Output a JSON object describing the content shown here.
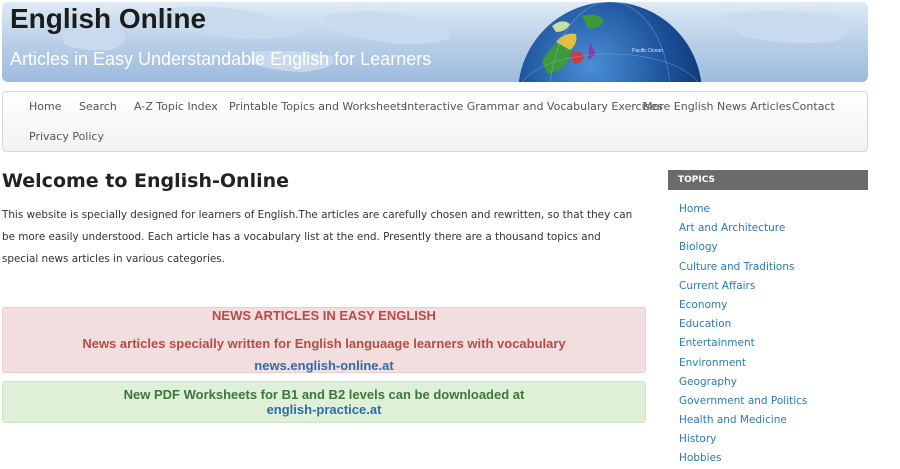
{
  "header": {
    "title": "English Online",
    "tagline": "Articles in Easy Understandable English for Learners",
    "globe_label": "Pacific Ocean"
  },
  "nav": {
    "items": [
      "Home",
      "Search",
      "A-Z Topic Index",
      "Printable Topics and Worksheets",
      "Interactive Grammar and Vocabulary Exercises",
      "More English News Articles",
      "Contact",
      "Privacy Policy"
    ]
  },
  "main": {
    "heading": "Welcome to English-Online",
    "intro": "This website is specially designed for learners of English.The articles are carefully chosen and rewritten, so that they can be more easily understood. Each article has a vocabulary list at the end. Presently there are a thousand topics and special news articles in various categories.",
    "news_box": {
      "heading": "NEWS ARTICLES IN EASY ENGLISH",
      "text": "News articles specially written for English languaage learners with vocabulary",
      "link": "news.english-online.at"
    },
    "pdf_box": {
      "text": "New PDF Worksheets for B1 and B2 levels can be downloaded at",
      "link": "english-practice.at"
    }
  },
  "sidebar": {
    "heading": "TOPICS",
    "items": [
      "Home",
      "Art and Architecture",
      "Biology",
      "Culture and Traditions",
      "Current Affairs",
      "Economy",
      "Education",
      "Entertainment",
      "Environment",
      "Geography",
      "Government and Politics",
      "Health and Medicine",
      "History",
      "Hobbies"
    ]
  },
  "colors": {
    "banner_blue": "#b6cde6",
    "alert_red_bg": "#f2dede",
    "alert_red_text": "#b94a48",
    "alert_green_bg": "#dff0d8",
    "alert_green_text": "#3c763d",
    "link_blue": "#2a7bb8",
    "sidebar_header_bg": "#6b6b6b"
  }
}
